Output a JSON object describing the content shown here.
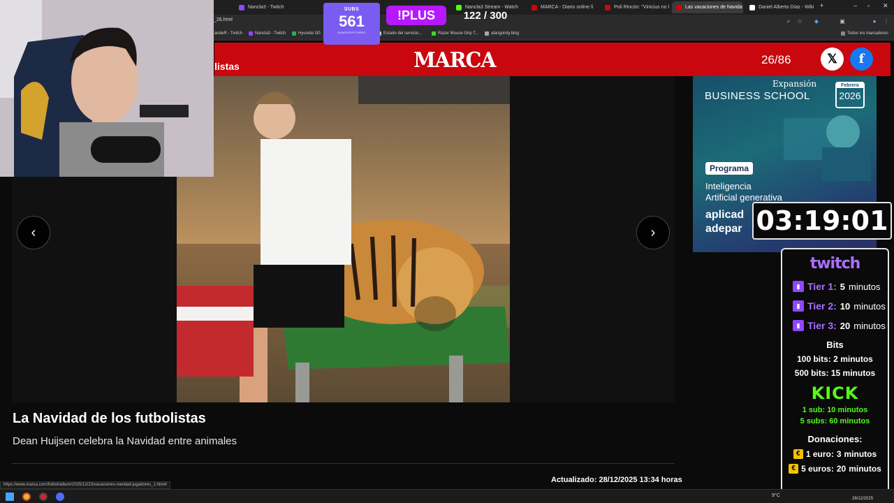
{
  "browser": {
    "tabs": [
      {
        "label": "Nancla3 - Twitch",
        "color": "#9146ff"
      },
      {
        "label": "Nancla3 Stream - Watch",
        "color": "#53fc18"
      },
      {
        "label": "MARCA - Diario online lí",
        "color": "#c8080e"
      },
      {
        "label": "Poli Rincón: \"Vinicius no l",
        "color": "#c8080e"
      },
      {
        "label": "Las vacaciones de Navida",
        "color": "#c8080e"
      },
      {
        "label": "Daniel Alberto Díaz - Wiki",
        "color": "#ffffff"
      }
    ],
    "url": "_26.html",
    "bookmarks": [
      "andeR - Twitch",
      "Nancla3 - Twitch",
      "Hyundai i30",
      "Estado del servicio...",
      "Razer Mouse Grip T...",
      "alanguloty.blog"
    ],
    "bookmarks_all": "Todos los marcadores"
  },
  "marca": {
    "left_text": "listas",
    "logo": "MARCA",
    "counter": "26/86",
    "x_icon": "x-logo-icon",
    "fb_icon": "facebook-icon"
  },
  "gallery": {
    "prev_glyph": "‹",
    "next_glyph": "›",
    "title": "La Navidad de los futbolistas",
    "subtitle": "Dean Huijsen celebra la Navidad entre animales",
    "updated": "Actualizado: 28/12/2025 13:34 horas",
    "status_url": "https://www.marca.com/futbol/album/2025/12/23/vacaciones-navidad-jugadores_1.html#"
  },
  "ad": {
    "brand": "Expansión",
    "school": "BUSINESS SCHOOL",
    "cal_month": "Febrero",
    "cal_year": "2026",
    "pill": "Programa",
    "l1": "Inteligencia",
    "l2": "Artificial generativa",
    "l3": "aplicad",
    "l4": "adepar"
  },
  "overlay": {
    "subs_label": "SUBS",
    "subs_value": "561",
    "subs_foot": "SUBSCRIPTORES",
    "plus": "!PLUS",
    "goal": "122 / 300",
    "timer": "03:19:01",
    "twitch_logo": "twitch",
    "tiers": [
      {
        "label": "Tier 1:",
        "value": "5",
        "unit": "minutos"
      },
      {
        "label": "Tier 2:",
        "value": "10",
        "unit": "minutos"
      },
      {
        "label": "Tier 3:",
        "value": "20",
        "unit": "minutos"
      }
    ],
    "bits_title": "Bits",
    "bits": [
      {
        "label": "100 bits:",
        "value": "2",
        "unit": "minutos"
      },
      {
        "label": "500 bits:",
        "value": "15",
        "unit": "minutos"
      }
    ],
    "kick_logo": "KICK",
    "kick": [
      {
        "label": "1 sub:",
        "value": "10",
        "unit": "minutos"
      },
      {
        "label": "5 subs:",
        "value": "60",
        "unit": "minutos"
      }
    ],
    "don_title": "Donaciones:",
    "donations": [
      {
        "label": "1 euro:",
        "value": "3",
        "unit": "minutos"
      },
      {
        "label": "5 euros:",
        "value": "20",
        "unit": "minutos"
      }
    ]
  },
  "taskbar": {
    "temp": "9°C",
    "date": "28/12/2025"
  }
}
